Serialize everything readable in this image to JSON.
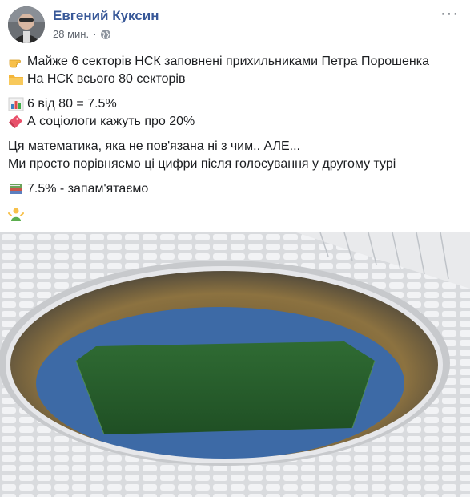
{
  "post": {
    "author": "Евгений Куксин",
    "time": "28 мин.",
    "separator": "·",
    "privacy_icon": "globe-icon",
    "more_icon": "more-options-icon",
    "lines": [
      {
        "emoji": "backhand-index-pointing-right",
        "text": "Майже 6 секторів НСК заповнені прихильниками Петра Порошенка"
      },
      {
        "emoji": "file-folder",
        "text": "На НСК всього 80 секторів"
      },
      {
        "emoji": "bar-chart",
        "text": "6 від 80 = 7.5%"
      },
      {
        "emoji": "ticket",
        "text": "А соціологи кажуть про 20%"
      },
      {
        "emoji": "",
        "text": "Ця математика, яка не пов'язана ні з чим.. АЛЕ..."
      },
      {
        "emoji": "",
        "text": "Ми просто порівняємо ці цифри після голосування у другому турі"
      },
      {
        "emoji": "books",
        "text": "7.5% - запам'ятаємо"
      },
      {
        "emoji": "person-shrugging",
        "text": ""
      }
    ],
    "image": {
      "subject": "stadium"
    }
  }
}
